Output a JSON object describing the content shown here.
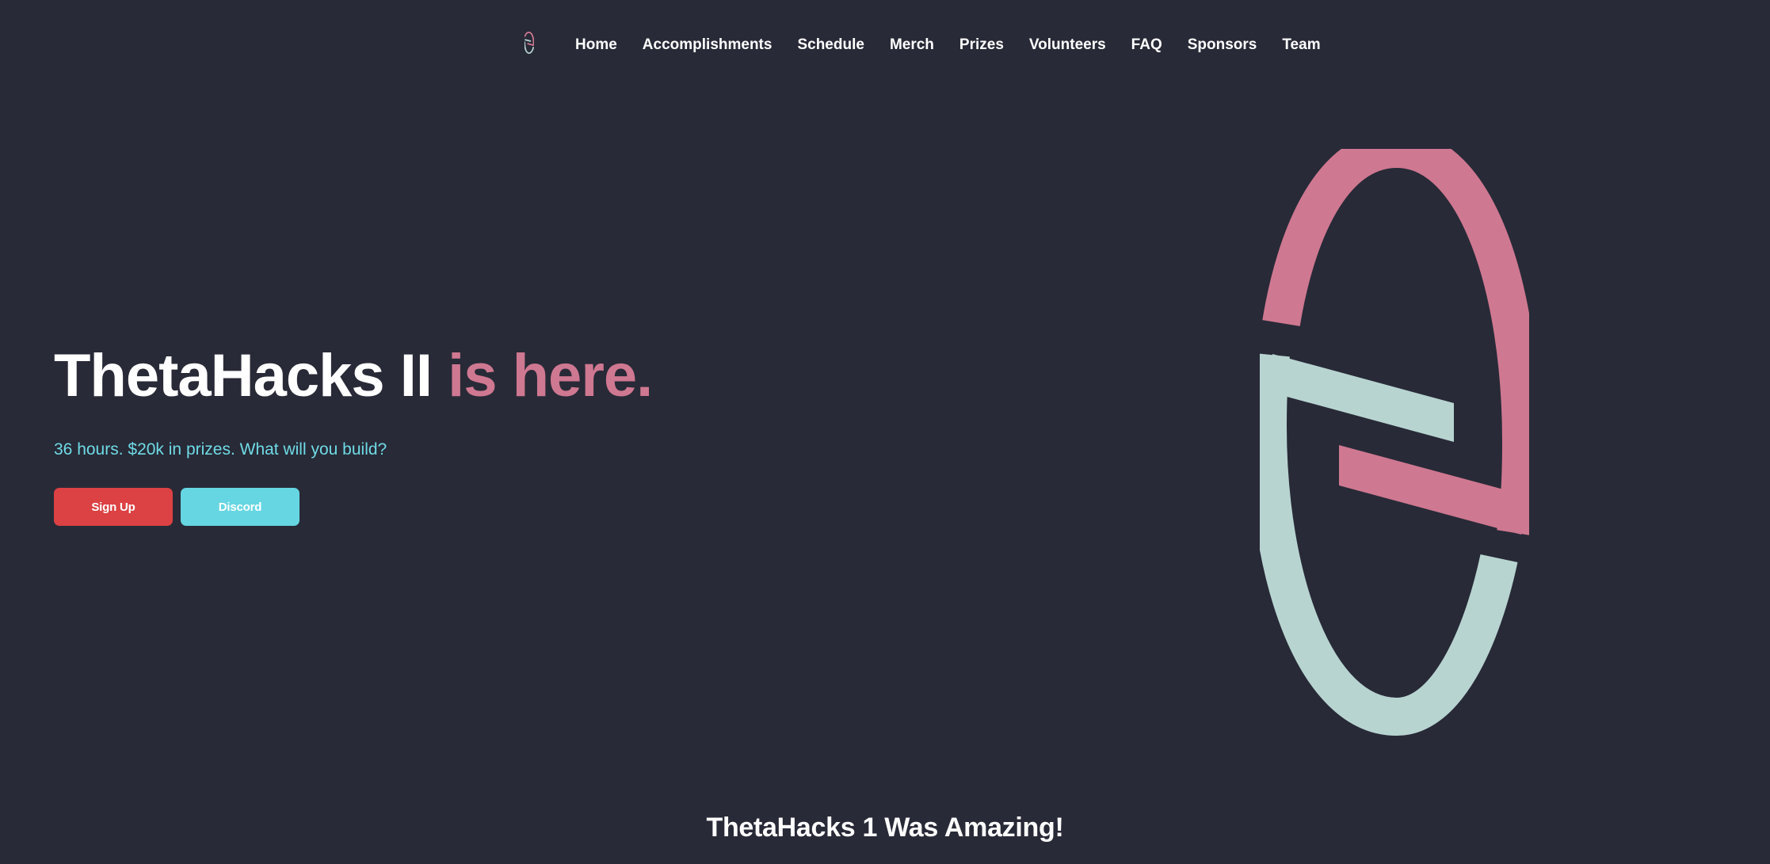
{
  "nav": {
    "logo_icon": "thetahacks-logo-icon",
    "items": [
      {
        "label": "Home"
      },
      {
        "label": "Accomplishments"
      },
      {
        "label": "Schedule"
      },
      {
        "label": "Merch"
      },
      {
        "label": "Prizes"
      },
      {
        "label": "Volunteers"
      },
      {
        "label": "FAQ"
      },
      {
        "label": "Sponsors"
      },
      {
        "label": "Team"
      }
    ]
  },
  "hero": {
    "title_main": "ThetaHacks II",
    "title_accent": "is here.",
    "subtitle": "36 hours. $20k in prizes. What will you build?",
    "signup_label": "Sign Up",
    "discord_label": "Discord",
    "logo_icon": "thetahacks-large-logo-icon"
  },
  "section": {
    "title": "ThetaHacks 1 Was Amazing!"
  },
  "colors": {
    "background": "#282a37",
    "accent_pink": "#cf7891",
    "accent_cyan": "#6fdbe6",
    "signup_red": "#dc4143",
    "discord_cyan": "#66d6e3",
    "logo_mint": "#b8d4d1"
  }
}
